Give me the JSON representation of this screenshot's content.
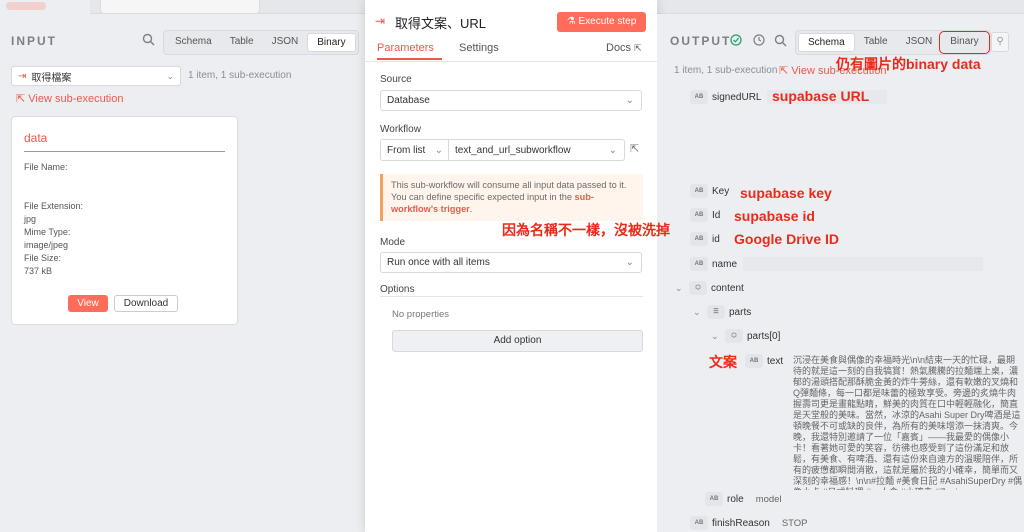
{
  "input": {
    "title": "INPUT",
    "tabs": [
      "Schema",
      "Table",
      "JSON",
      "Binary"
    ],
    "active_tab": "Binary",
    "node_select": "取得檔案",
    "item_info": "1 item, 1 sub-execution",
    "view_sub_execution": "View sub-execution",
    "card": {
      "title": "data",
      "file_name_label": "File Name:",
      "file_extension_label": "File Extension:",
      "file_extension_value": "jpg",
      "mime_type_label": "Mime Type:",
      "mime_type_value": "image/jpeg",
      "file_size_label": "File Size:",
      "file_size_value": "737 kB",
      "view_button": "View",
      "download_button": "Download"
    }
  },
  "modal": {
    "title": "取得文案、URL",
    "execute_button": "Execute step",
    "tabs": [
      "Parameters",
      "Settings"
    ],
    "docs": "Docs",
    "source_label": "Source",
    "source_value": "Database",
    "workflow_label": "Workflow",
    "workflow_mode": "From list",
    "workflow_value": "text_and_url_subworkflow",
    "notice_text": "This sub-workflow will consume all input data passed to it. You can define specific expected input in the ",
    "notice_em": "sub-workflow's trigger",
    "notice_end": ".",
    "mode_label": "Mode",
    "mode_value": "Run once with all items",
    "options_label": "Options",
    "no_properties": "No properties",
    "add_option": "Add option"
  },
  "output": {
    "title": "OUTPUT",
    "tabs": [
      "Schema",
      "Table",
      "JSON",
      "Binary"
    ],
    "active_tab": "Schema",
    "item_info": "1 item, 1 sub-execution",
    "view_sub_execution": "View sub-execution",
    "fields": {
      "signedURL": "signedURL",
      "key": "Key",
      "id1": "Id",
      "id2": "id",
      "name": "name",
      "content": "content",
      "parts": "parts",
      "parts0": "parts[0]",
      "text": "text",
      "role": "role",
      "role_value": "model",
      "finishReason": "finishReason",
      "finishReason_value": "STOP"
    },
    "text_value": "沉浸在美食與偶像的幸福時光\\n\\n結束一天的忙碌，最期待的就是這一刻的自我犒賞！熱氣騰騰的拉麵端上桌，濃郁的湯頭搭配那酥脆金黃的炸牛蒡絲，還有軟嫩的叉燒和Q彈麵條，每一口都是味蕾的極致享受。旁邊的炙燒牛肉握壽司更是畫龍點睛，鮮美的肉質在口中輕輕融化，簡直是天堂般的美味。當然，冰涼的Asahi Super Dry啤酒是這頓晚餐不可或缺的良伴，為所有的美味增添一抹清爽。今晚，我還特別邀請了一位「嘉賓」——我最愛的偶像小卡！看著她可愛的笑容，彷彿也感受到了這份滿足和放鬆，有美食、有啤酒、還有這份來自遠方的溫暖陪伴，所有的疲憊都瞬間消散，這就是屬於我的小確幸，簡單而又深刻的幸福感！\\n\\n#拉麵 #美食日記 #AsahiSuperDry #偶像小卡 #日式料理 #一人食 #小確幸 #Zagin"
  },
  "annotations": {
    "binary": "仍有圖片的binary data",
    "supabase_url": "supabase URL",
    "supabase_key": "supabase key",
    "supabase_id": "supabase id",
    "google_drive_id": "Google Drive ID",
    "name_note": "因為名稱不一樣，沒被洗掉",
    "text_note": "文案"
  },
  "colors": {
    "accent": "#ff6d5a",
    "annotation": "#ea2b1a",
    "panel": "#eceef1"
  }
}
